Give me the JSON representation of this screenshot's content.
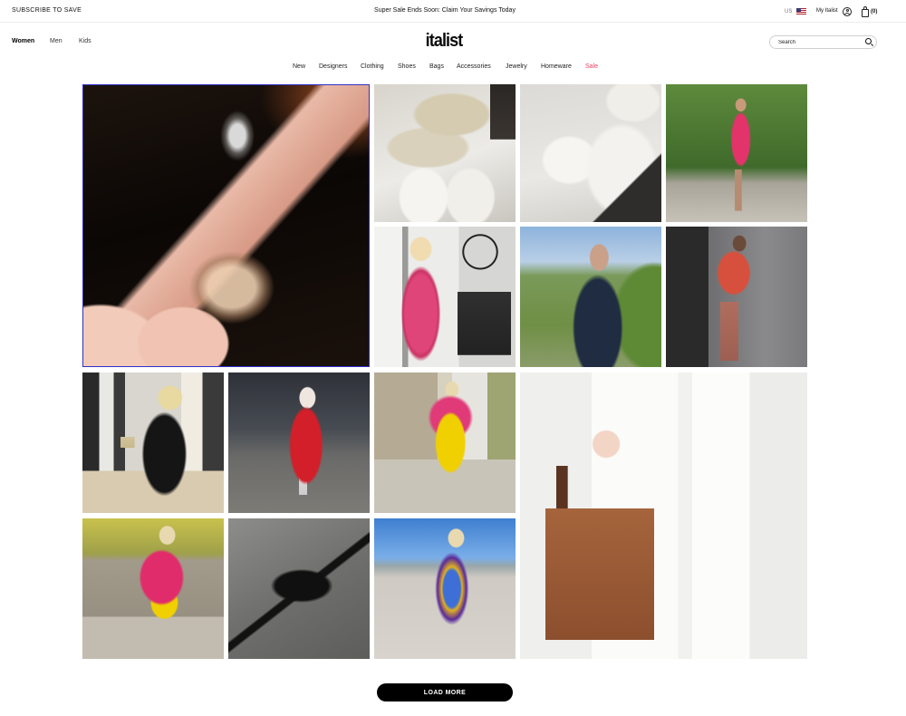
{
  "colors": {
    "sale": "#e8405f",
    "focus_outline": "#3030c8",
    "button_bg": "#000000"
  },
  "icons": {
    "flag": "us-flag-icon",
    "account": "user-icon",
    "cart": "shopping-bag-icon",
    "search": "search-icon"
  },
  "topbar": {
    "subscribe": "SUBSCRIBE TO SAVE",
    "promo": "Super Sale Ends Soon: Claim Your Savings Today",
    "region": "US",
    "account": "My Italist",
    "cart_count": "(0)"
  },
  "header": {
    "tabs": [
      "Women",
      "Men",
      "Kids"
    ],
    "logo": "italist",
    "search": {
      "placeholder": "Search",
      "value": ""
    }
  },
  "nav": {
    "items": [
      "New",
      "Designers",
      "Clothing",
      "Shoes",
      "Bags",
      "Accessories",
      "Jewelry",
      "Homeware",
      "Sale"
    ]
  },
  "load_more": "LOAD MORE"
}
